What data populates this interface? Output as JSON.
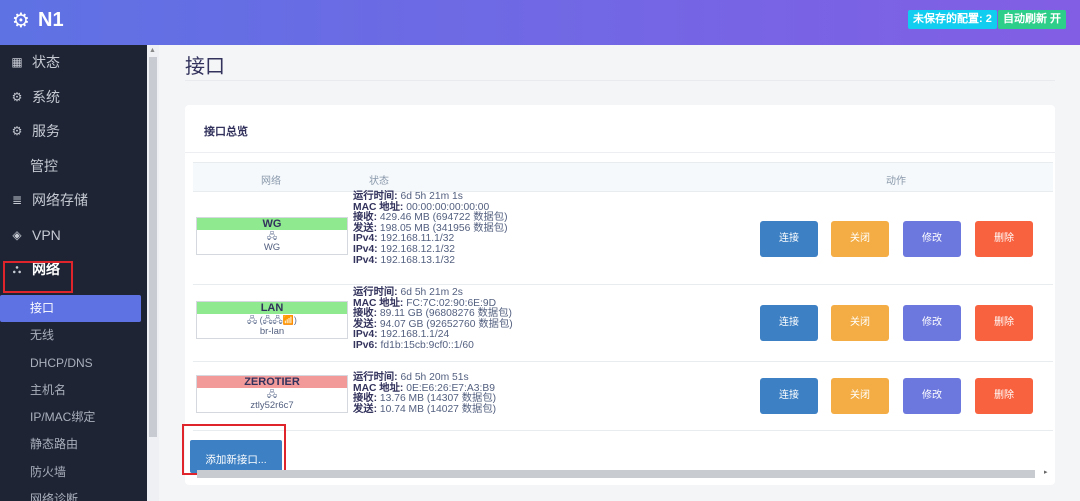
{
  "header": {
    "title": "N1",
    "unsaved_label": "未保存的配置: 2",
    "refresh_label": "自动刷新 开",
    "colors": {
      "gradient_start": "#5e72e4",
      "gradient_end": "#825ee4"
    }
  },
  "sidebar": {
    "items": [
      {
        "label": "状态",
        "icon": "grid-icon"
      },
      {
        "label": "系统",
        "icon": "gear-icon"
      },
      {
        "label": "服务",
        "icon": "cogs-icon"
      },
      {
        "label": "管控",
        "icon": ""
      },
      {
        "label": "网络存储",
        "icon": "database-icon"
      },
      {
        "label": "VPN",
        "icon": "vpn-icon"
      },
      {
        "label": "网络",
        "icon": "sitemap-icon"
      }
    ],
    "sub_items": [
      "接口",
      "无线",
      "DHCP/DNS",
      "主机名",
      "IP/MAC绑定",
      "静态路由",
      "防火墙",
      "网络诊断"
    ]
  },
  "page": {
    "title": "接口",
    "panel_title": "接口总览",
    "columns": {
      "network": "网络",
      "status": "状态",
      "actions": "动作"
    },
    "add_button": "添加新接口..."
  },
  "interfaces": [
    {
      "name": "WG",
      "device": "WG",
      "icons": "🖧",
      "color": "green",
      "uptime": "6d 5h 21m 1s",
      "mac": "00:00:00:00:00:00",
      "rx": "429.46 MB (694722 数据包)",
      "tx": "198.05 MB (341956 数据包)",
      "ipv4": [
        "192.168.11.1/32",
        "192.168.12.1/32",
        "192.168.13.1/32"
      ],
      "ipv6": []
    },
    {
      "name": "LAN",
      "device": "br-lan",
      "icons": "🖧 (🖧🖧📶)",
      "color": "green",
      "uptime": "6d 5h 21m 2s",
      "mac": "FC:7C:02:90:6E:9D",
      "rx": "89.11 GB (96808276 数据包)",
      "tx": "94.07 GB (92652760 数据包)",
      "ipv4": [
        "192.168.1.1/24"
      ],
      "ipv6": [
        "fd1b:15cb:9cf0::1/60"
      ]
    },
    {
      "name": "ZEROTIER",
      "device": "ztly52r6c7",
      "icons": "🖧",
      "color": "red",
      "uptime": "6d 5h 20m 51s",
      "mac": "0E:E6:26:E7:A3:B9",
      "rx": "13.76 MB (14307 数据包)",
      "tx": "10.74 MB (14027 数据包)",
      "ipv4": [],
      "ipv6": []
    }
  ],
  "labels": {
    "uptime": "运行时间:",
    "mac": "MAC 地址:",
    "rx": "接收:",
    "tx": "发送:",
    "ipv4": "IPv4:",
    "ipv6": "IPv6:"
  },
  "actions": {
    "connect": "连接",
    "close": "关闭",
    "edit": "修改",
    "delete": "删除"
  }
}
